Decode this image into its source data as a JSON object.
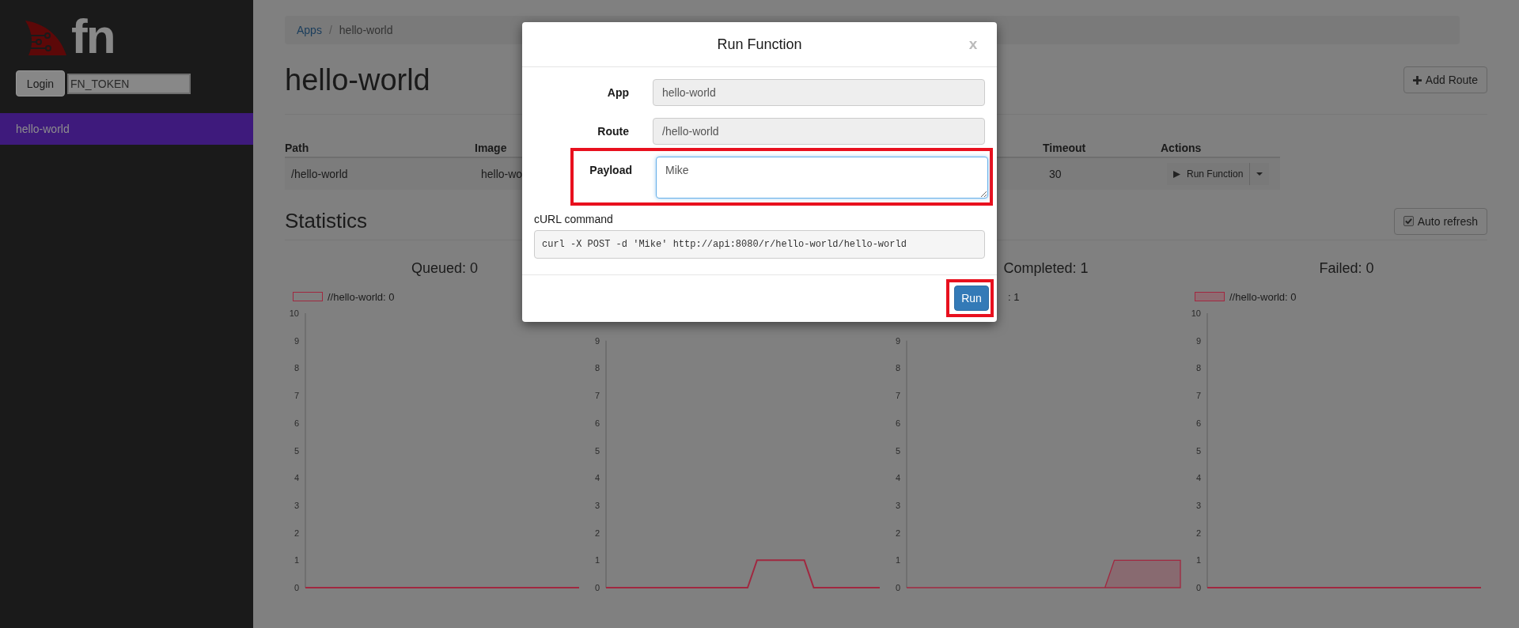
{
  "sidebar": {
    "logo_text": "fn",
    "login_button": "Login",
    "token_field": {
      "value": "FN_TOKEN"
    },
    "items": [
      {
        "label": "hello-world",
        "selected": true
      }
    ]
  },
  "breadcrumb": {
    "separator": "/",
    "items": [
      {
        "label": "Apps",
        "kind": "link"
      },
      {
        "label": "hello-world",
        "kind": "current"
      }
    ]
  },
  "page_title": "hello-world",
  "add_route_button": "Add Route",
  "routes_table": {
    "columns": [
      "Path",
      "Image",
      "Timeout",
      "Actions"
    ],
    "rows": [
      {
        "path": "/hello-world",
        "image": "hello-wo",
        "timeout": "30",
        "action_button": "Run Function"
      }
    ]
  },
  "statistics": {
    "title": "Statistics",
    "auto_refresh": {
      "label": "Auto refresh",
      "checked": true
    },
    "charts": [
      {
        "title": "Queued: 0",
        "legend": {
          "text": "//hello-world: 0",
          "kind": "outline"
        },
        "chart_data": {
          "type": "line",
          "ylim": [
            0,
            10
          ],
          "yticks": [
            0,
            1,
            2,
            3,
            4,
            5,
            6,
            7,
            8,
            9,
            10
          ],
          "series": [
            {
              "color": "#a02840",
              "values": [
                0,
                0,
                0,
                0,
                0,
                0,
                0,
                0,
                0,
                0,
                0,
                0,
                0,
                0,
                0,
                0,
                0,
                0,
                0,
                0,
                0,
                0,
                0,
                0,
                0,
                0,
                0,
                0,
                0,
                0
              ]
            }
          ]
        }
      },
      {
        "chart_data": {
          "type": "line",
          "ylim": [
            0,
            9
          ],
          "yticks": [
            0,
            1,
            2,
            3,
            4,
            5,
            6,
            7,
            8,
            9
          ],
          "series": [
            {
              "color": "#a02840",
              "values": [
                0,
                0,
                0,
                0,
                0,
                0,
                0,
                0,
                0,
                0,
                0,
                0,
                0,
                0,
                0,
                0,
                1,
                1,
                1,
                1,
                1,
                1,
                0,
                0,
                0,
                0,
                0,
                0,
                0,
                0
              ]
            }
          ]
        }
      },
      {
        "title": "Completed: 1",
        "legend": {
          "text": ": 1",
          "kind": "text"
        },
        "chart_data": {
          "type": "area",
          "ylim": [
            0,
            9
          ],
          "yticks": [
            0,
            1,
            2,
            3,
            4,
            5,
            6,
            7,
            8,
            9
          ],
          "series": [
            {
              "color": "#a02840",
              "values": [
                0,
                0,
                0,
                0,
                0,
                0,
                0,
                0,
                0,
                0,
                0,
                0,
                0,
                0,
                0,
                0,
                0,
                0,
                0,
                0,
                0,
                0,
                1,
                1,
                1,
                1,
                1,
                1,
                1,
                1
              ]
            }
          ]
        }
      },
      {
        "title": "Failed: 0",
        "legend": {
          "text": "//hello-world: 0",
          "kind": "filled"
        },
        "chart_data": {
          "type": "line",
          "ylim": [
            0,
            10
          ],
          "yticks": [
            0,
            1,
            2,
            3,
            4,
            5,
            6,
            7,
            8,
            9,
            10
          ],
          "series": [
            {
              "color": "#a02840",
              "values": [
                0,
                0,
                0,
                0,
                0,
                0,
                0,
                0,
                0,
                0,
                0,
                0,
                0,
                0,
                0,
                0,
                0,
                0,
                0,
                0,
                0,
                0,
                0,
                0,
                0,
                0,
                0,
                0,
                0,
                0
              ]
            }
          ]
        }
      }
    ]
  },
  "run_dialog": {
    "title": "Run Function",
    "close": "x",
    "fields": [
      {
        "label": "App",
        "value": "hello-world",
        "kind": "readonly",
        "highlighted": false
      },
      {
        "label": "Route",
        "value": "/hello-world",
        "kind": "readonly",
        "highlighted": false
      },
      {
        "label": "Payload",
        "value": "Mike",
        "kind": "textarea",
        "highlighted": true
      }
    ],
    "curl_label": "cURL command",
    "curl_command": "curl -X POST -d 'Mike' http://api:8080/r/hello-world/hello-world",
    "run_button": {
      "label": "Run",
      "highlighted": true
    }
  }
}
